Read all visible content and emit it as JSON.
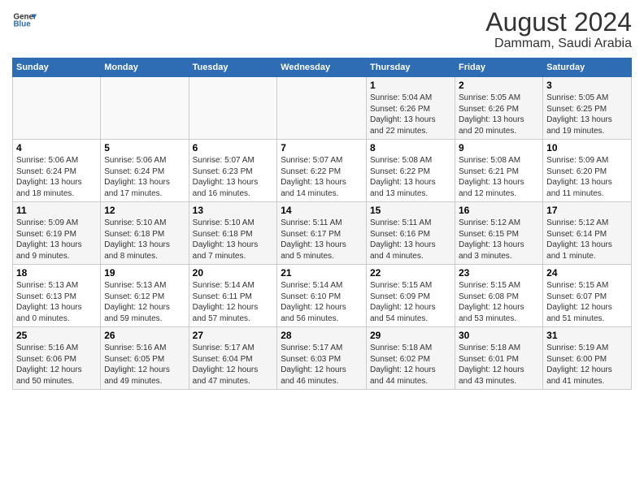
{
  "header": {
    "logo_line1": "General",
    "logo_line2": "Blue",
    "main_title": "August 2024",
    "subtitle": "Dammam, Saudi Arabia"
  },
  "days_of_week": [
    "Sunday",
    "Monday",
    "Tuesday",
    "Wednesday",
    "Thursday",
    "Friday",
    "Saturday"
  ],
  "weeks": [
    [
      {
        "num": "",
        "info": ""
      },
      {
        "num": "",
        "info": ""
      },
      {
        "num": "",
        "info": ""
      },
      {
        "num": "",
        "info": ""
      },
      {
        "num": "1",
        "info": "Sunrise: 5:04 AM\nSunset: 6:26 PM\nDaylight: 13 hours\nand 22 minutes."
      },
      {
        "num": "2",
        "info": "Sunrise: 5:05 AM\nSunset: 6:26 PM\nDaylight: 13 hours\nand 20 minutes."
      },
      {
        "num": "3",
        "info": "Sunrise: 5:05 AM\nSunset: 6:25 PM\nDaylight: 13 hours\nand 19 minutes."
      }
    ],
    [
      {
        "num": "4",
        "info": "Sunrise: 5:06 AM\nSunset: 6:24 PM\nDaylight: 13 hours\nand 18 minutes."
      },
      {
        "num": "5",
        "info": "Sunrise: 5:06 AM\nSunset: 6:24 PM\nDaylight: 13 hours\nand 17 minutes."
      },
      {
        "num": "6",
        "info": "Sunrise: 5:07 AM\nSunset: 6:23 PM\nDaylight: 13 hours\nand 16 minutes."
      },
      {
        "num": "7",
        "info": "Sunrise: 5:07 AM\nSunset: 6:22 PM\nDaylight: 13 hours\nand 14 minutes."
      },
      {
        "num": "8",
        "info": "Sunrise: 5:08 AM\nSunset: 6:22 PM\nDaylight: 13 hours\nand 13 minutes."
      },
      {
        "num": "9",
        "info": "Sunrise: 5:08 AM\nSunset: 6:21 PM\nDaylight: 13 hours\nand 12 minutes."
      },
      {
        "num": "10",
        "info": "Sunrise: 5:09 AM\nSunset: 6:20 PM\nDaylight: 13 hours\nand 11 minutes."
      }
    ],
    [
      {
        "num": "11",
        "info": "Sunrise: 5:09 AM\nSunset: 6:19 PM\nDaylight: 13 hours\nand 9 minutes."
      },
      {
        "num": "12",
        "info": "Sunrise: 5:10 AM\nSunset: 6:18 PM\nDaylight: 13 hours\nand 8 minutes."
      },
      {
        "num": "13",
        "info": "Sunrise: 5:10 AM\nSunset: 6:18 PM\nDaylight: 13 hours\nand 7 minutes."
      },
      {
        "num": "14",
        "info": "Sunrise: 5:11 AM\nSunset: 6:17 PM\nDaylight: 13 hours\nand 5 minutes."
      },
      {
        "num": "15",
        "info": "Sunrise: 5:11 AM\nSunset: 6:16 PM\nDaylight: 13 hours\nand 4 minutes."
      },
      {
        "num": "16",
        "info": "Sunrise: 5:12 AM\nSunset: 6:15 PM\nDaylight: 13 hours\nand 3 minutes."
      },
      {
        "num": "17",
        "info": "Sunrise: 5:12 AM\nSunset: 6:14 PM\nDaylight: 13 hours\nand 1 minute."
      }
    ],
    [
      {
        "num": "18",
        "info": "Sunrise: 5:13 AM\nSunset: 6:13 PM\nDaylight: 13 hours\nand 0 minutes."
      },
      {
        "num": "19",
        "info": "Sunrise: 5:13 AM\nSunset: 6:12 PM\nDaylight: 12 hours\nand 59 minutes."
      },
      {
        "num": "20",
        "info": "Sunrise: 5:14 AM\nSunset: 6:11 PM\nDaylight: 12 hours\nand 57 minutes."
      },
      {
        "num": "21",
        "info": "Sunrise: 5:14 AM\nSunset: 6:10 PM\nDaylight: 12 hours\nand 56 minutes."
      },
      {
        "num": "22",
        "info": "Sunrise: 5:15 AM\nSunset: 6:09 PM\nDaylight: 12 hours\nand 54 minutes."
      },
      {
        "num": "23",
        "info": "Sunrise: 5:15 AM\nSunset: 6:08 PM\nDaylight: 12 hours\nand 53 minutes."
      },
      {
        "num": "24",
        "info": "Sunrise: 5:15 AM\nSunset: 6:07 PM\nDaylight: 12 hours\nand 51 minutes."
      }
    ],
    [
      {
        "num": "25",
        "info": "Sunrise: 5:16 AM\nSunset: 6:06 PM\nDaylight: 12 hours\nand 50 minutes."
      },
      {
        "num": "26",
        "info": "Sunrise: 5:16 AM\nSunset: 6:05 PM\nDaylight: 12 hours\nand 49 minutes."
      },
      {
        "num": "27",
        "info": "Sunrise: 5:17 AM\nSunset: 6:04 PM\nDaylight: 12 hours\nand 47 minutes."
      },
      {
        "num": "28",
        "info": "Sunrise: 5:17 AM\nSunset: 6:03 PM\nDaylight: 12 hours\nand 46 minutes."
      },
      {
        "num": "29",
        "info": "Sunrise: 5:18 AM\nSunset: 6:02 PM\nDaylight: 12 hours\nand 44 minutes."
      },
      {
        "num": "30",
        "info": "Sunrise: 5:18 AM\nSunset: 6:01 PM\nDaylight: 12 hours\nand 43 minutes."
      },
      {
        "num": "31",
        "info": "Sunrise: 5:19 AM\nSunset: 6:00 PM\nDaylight: 12 hours\nand 41 minutes."
      }
    ]
  ]
}
